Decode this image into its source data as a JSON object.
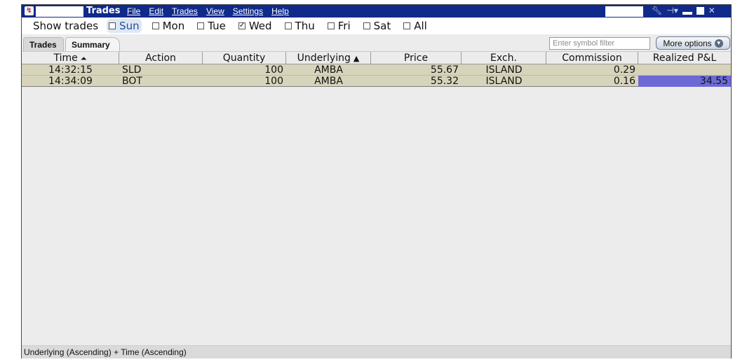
{
  "window": {
    "title": "Trades",
    "menu": [
      {
        "label": "File"
      },
      {
        "label": "Edit"
      },
      {
        "label": "Trades"
      },
      {
        "label": "View"
      },
      {
        "label": "Settings"
      },
      {
        "label": "Help"
      }
    ],
    "icons": [
      "app-logo-icon",
      "wrench-icon",
      "pin-icon",
      "minimize-icon",
      "maximize-icon",
      "close-icon"
    ]
  },
  "show_trades": {
    "label": "Show trades",
    "days": [
      {
        "label": "Sun",
        "checked": false,
        "active": true
      },
      {
        "label": "Mon",
        "checked": false,
        "active": false
      },
      {
        "label": "Tue",
        "checked": false,
        "active": false
      },
      {
        "label": "Wed",
        "checked": true,
        "active": false
      },
      {
        "label": "Thu",
        "checked": false,
        "active": false
      },
      {
        "label": "Fri",
        "checked": false,
        "active": false
      },
      {
        "label": "Sat",
        "checked": false,
        "active": false
      },
      {
        "label": "All",
        "checked": false,
        "active": false
      }
    ]
  },
  "tabs": [
    {
      "label": "Trades"
    },
    {
      "label": "Summary"
    }
  ],
  "filter": {
    "placeholder": "Enter symbol filter"
  },
  "more_options": {
    "label": "More options"
  },
  "table": {
    "columns": [
      "Time",
      "Action",
      "Quantity",
      "Underlying",
      "Price",
      "Exch.",
      "Commission",
      "Realized P&L"
    ],
    "rows": [
      {
        "time": "14:32:15",
        "action": "SLD",
        "quantity": "100",
        "underlying": "AMBA",
        "price": "55.67",
        "exch": "ISLAND",
        "commission": "0.29",
        "pnl": ""
      },
      {
        "time": "14:34:09",
        "action": "BOT",
        "quantity": "100",
        "underlying": "AMBA",
        "price": "55.32",
        "exch": "ISLAND",
        "commission": "0.16",
        "pnl": "34.55"
      }
    ]
  },
  "status_bar": {
    "text": "Underlying (Ascending) + Time (Ascending)"
  },
  "colors": {
    "title_bar": "#0f2a8a",
    "row_background": "#d8d4bc",
    "pnl_positive": "#6c6ad6"
  }
}
